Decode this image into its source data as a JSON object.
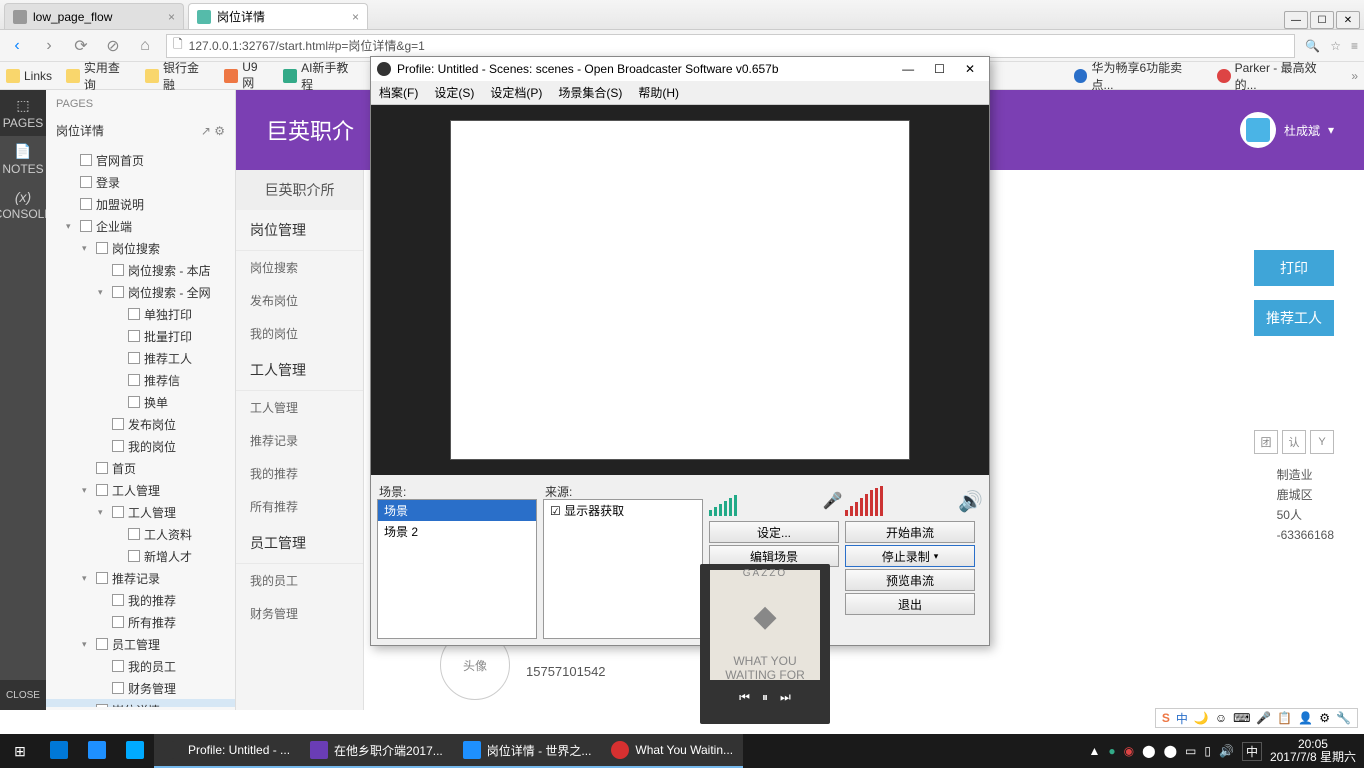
{
  "browser": {
    "tabs": [
      {
        "label": "low_page_flow",
        "active": false
      },
      {
        "label": "岗位详情",
        "active": true
      }
    ],
    "url": "127.0.0.1:32767/start.html#p=岗位详情&g=1",
    "bookmarks": [
      "Links",
      "实用查询",
      "银行金融",
      "U9网",
      "AI新手教程",
      "华为畅享6功能卖点...",
      "Parker - 最高效的..."
    ]
  },
  "rail": {
    "items": [
      {
        "icon": "⬚",
        "label": "PAGES"
      },
      {
        "icon": "📄",
        "label": "NOTES"
      },
      {
        "icon": "(x)",
        "label": "CONSOLE"
      }
    ],
    "close": "CLOSE"
  },
  "pages": {
    "header": "PAGES",
    "subheader": "岗位详情",
    "tree": [
      {
        "t": "官网首页",
        "l": 1
      },
      {
        "t": "登录",
        "l": 1
      },
      {
        "t": "加盟说明",
        "l": 1
      },
      {
        "t": "企业端",
        "l": 1,
        "c": "▾"
      },
      {
        "t": "岗位搜索",
        "l": 2,
        "c": "▾"
      },
      {
        "t": "岗位搜索 - 本店",
        "l": 3
      },
      {
        "t": "岗位搜索 - 全网",
        "l": 3,
        "c": "▾"
      },
      {
        "t": "单独打印",
        "l": 4
      },
      {
        "t": "批量打印",
        "l": 4
      },
      {
        "t": "推荐工人",
        "l": 4
      },
      {
        "t": "推荐信",
        "l": 4
      },
      {
        "t": "换单",
        "l": 4
      },
      {
        "t": "发布岗位",
        "l": 3
      },
      {
        "t": "我的岗位",
        "l": 3
      },
      {
        "t": "首页",
        "l": 2
      },
      {
        "t": "工人管理",
        "l": 2,
        "c": "▾"
      },
      {
        "t": "工人管理",
        "l": 3,
        "c": "▾"
      },
      {
        "t": "工人资料",
        "l": 4
      },
      {
        "t": "新增人才",
        "l": 4
      },
      {
        "t": "推荐记录",
        "l": 2,
        "c": "▾"
      },
      {
        "t": "我的推荐",
        "l": 3
      },
      {
        "t": "所有推荐",
        "l": 3
      },
      {
        "t": "员工管理",
        "l": 2,
        "c": "▾"
      },
      {
        "t": "我的员工",
        "l": 3
      },
      {
        "t": "财务管理",
        "l": 3
      },
      {
        "t": "岗位详情",
        "l": 2,
        "sel": true
      }
    ]
  },
  "app_sidebar": {
    "title": "巨英职介所",
    "sections": [
      {
        "hdr": "岗位管理",
        "items": [
          "岗位搜索",
          "发布岗位",
          "我的岗位"
        ]
      },
      {
        "hdr": "工人管理",
        "items": [
          "工人管理",
          "推荐记录",
          "我的推荐",
          "所有推荐"
        ]
      },
      {
        "hdr": "员工管理",
        "items": [
          "我的员工",
          "财务管理"
        ]
      }
    ]
  },
  "purple": {
    "title": "巨英职介",
    "user": "杜成斌"
  },
  "actions": {
    "print": "打印",
    "recommend": "推荐工人"
  },
  "details": {
    "badges": [
      "团",
      "认",
      "Y"
    ],
    "lines": [
      "制造业",
      "鹿城区",
      "50人",
      "-63366168"
    ]
  },
  "avatar_label": "头像",
  "phone": "15757101542",
  "obs": {
    "title": "Profile: Untitled - Scenes: scenes - Open Broadcaster Software v0.657b",
    "menu": [
      "档案(F)",
      "设定(S)",
      "设定档(P)",
      "场景集合(S)",
      "帮助(H)"
    ],
    "scene_label": "场景:",
    "source_label": "来源:",
    "scenes": [
      "场景",
      "场景 2"
    ],
    "sources": [
      "显示器获取"
    ],
    "buttons": {
      "settings": "设定...",
      "start_stream": "开始串流",
      "edit_scene": "编辑场景",
      "stop_record": "停止录制",
      "preview": "预览串流",
      "exit": "退出"
    }
  },
  "music": {
    "artist": "GAZZO",
    "track": "WHAT YOU WAITING FOR"
  },
  "ime": {
    "text": "中",
    "icons": [
      "🌙",
      "☺",
      "⌨",
      "🎤",
      "📋",
      "👤",
      "⚙",
      "🔧"
    ]
  },
  "taskbar": {
    "items": [
      {
        "label": "",
        "color": "#0078d7"
      },
      {
        "label": "",
        "color": "#1e90ff"
      },
      {
        "label": "",
        "color": "#00aaff"
      },
      {
        "label": "Profile: Untitled - ...",
        "color": "#333"
      },
      {
        "label": "在他乡职介端2017...",
        "color": "#6a3db5"
      },
      {
        "label": "岗位详情 - 世界之...",
        "color": "#1e90ff"
      },
      {
        "label": "What You Waitin...",
        "color": "#d63030"
      }
    ],
    "clock_time": "20:05",
    "clock_date": "2017/7/8 星期六",
    "lang": "中"
  }
}
